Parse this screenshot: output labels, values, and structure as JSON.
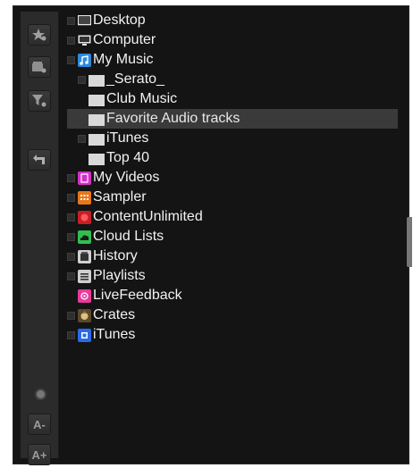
{
  "toolbar": {
    "buttons": [
      {
        "name": "favorite-star-icon"
      },
      {
        "name": "add-crate-icon"
      },
      {
        "name": "filter-icon"
      },
      {
        "name": "back-arrow-icon"
      }
    ],
    "font_smaller_label": "A-",
    "font_larger_label": "A+"
  },
  "tree": {
    "items": [
      {
        "label": "Desktop",
        "icon": "desktop-icon",
        "color": "#d9d9d9",
        "level": 0,
        "expander": true
      },
      {
        "label": "Computer",
        "icon": "computer-icon",
        "color": "#d9d9d9",
        "level": 0,
        "expander": true
      },
      {
        "label": "My Music",
        "icon": "music-icon",
        "color": "#2a8ae0",
        "level": 0,
        "expander": true
      },
      {
        "label": "_Serato_",
        "icon": "folder-icon",
        "color": "#d9d9d9",
        "level": 1,
        "expander": true
      },
      {
        "label": "Club Music",
        "icon": "folder-icon",
        "color": "#d9d9d9",
        "level": 1,
        "expander": false
      },
      {
        "label": "Favorite Audio tracks",
        "icon": "folder-icon",
        "color": "#d9d9d9",
        "level": 1,
        "expander": false,
        "selected": true
      },
      {
        "label": "iTunes",
        "icon": "folder-icon",
        "color": "#d9d9d9",
        "level": 1,
        "expander": true
      },
      {
        "label": "Top 40",
        "icon": "folder-icon",
        "color": "#d9d9d9",
        "level": 1,
        "expander": false
      },
      {
        "label": "My Videos",
        "icon": "video-icon",
        "color": "#d52fc9",
        "level": 0,
        "expander": true
      },
      {
        "label": "Sampler",
        "icon": "sampler-icon",
        "color": "#e8771a",
        "level": 0,
        "expander": true
      },
      {
        "label": "ContentUnlimited",
        "icon": "content-unlimited-icon",
        "color": "#d8232a",
        "level": 0,
        "expander": true
      },
      {
        "label": "Cloud Lists",
        "icon": "cloud-icon",
        "color": "#2fbf4f",
        "level": 0,
        "expander": true
      },
      {
        "label": "History",
        "icon": "history-icon",
        "color": "#cfcfcf",
        "level": 0,
        "expander": true
      },
      {
        "label": "Playlists",
        "icon": "playlist-icon",
        "color": "#cfcfcf",
        "level": 0,
        "expander": true
      },
      {
        "label": "LiveFeedback",
        "icon": "live-feedback-icon",
        "color": "#e83a9b",
        "level": 0,
        "expander": false
      },
      {
        "label": "Crates",
        "icon": "crates-icon",
        "color": "#9a7a42",
        "level": 0,
        "expander": true
      },
      {
        "label": "iTunes",
        "icon": "itunes-icon",
        "color": "#2a6ae6",
        "level": 0,
        "expander": true
      }
    ]
  }
}
